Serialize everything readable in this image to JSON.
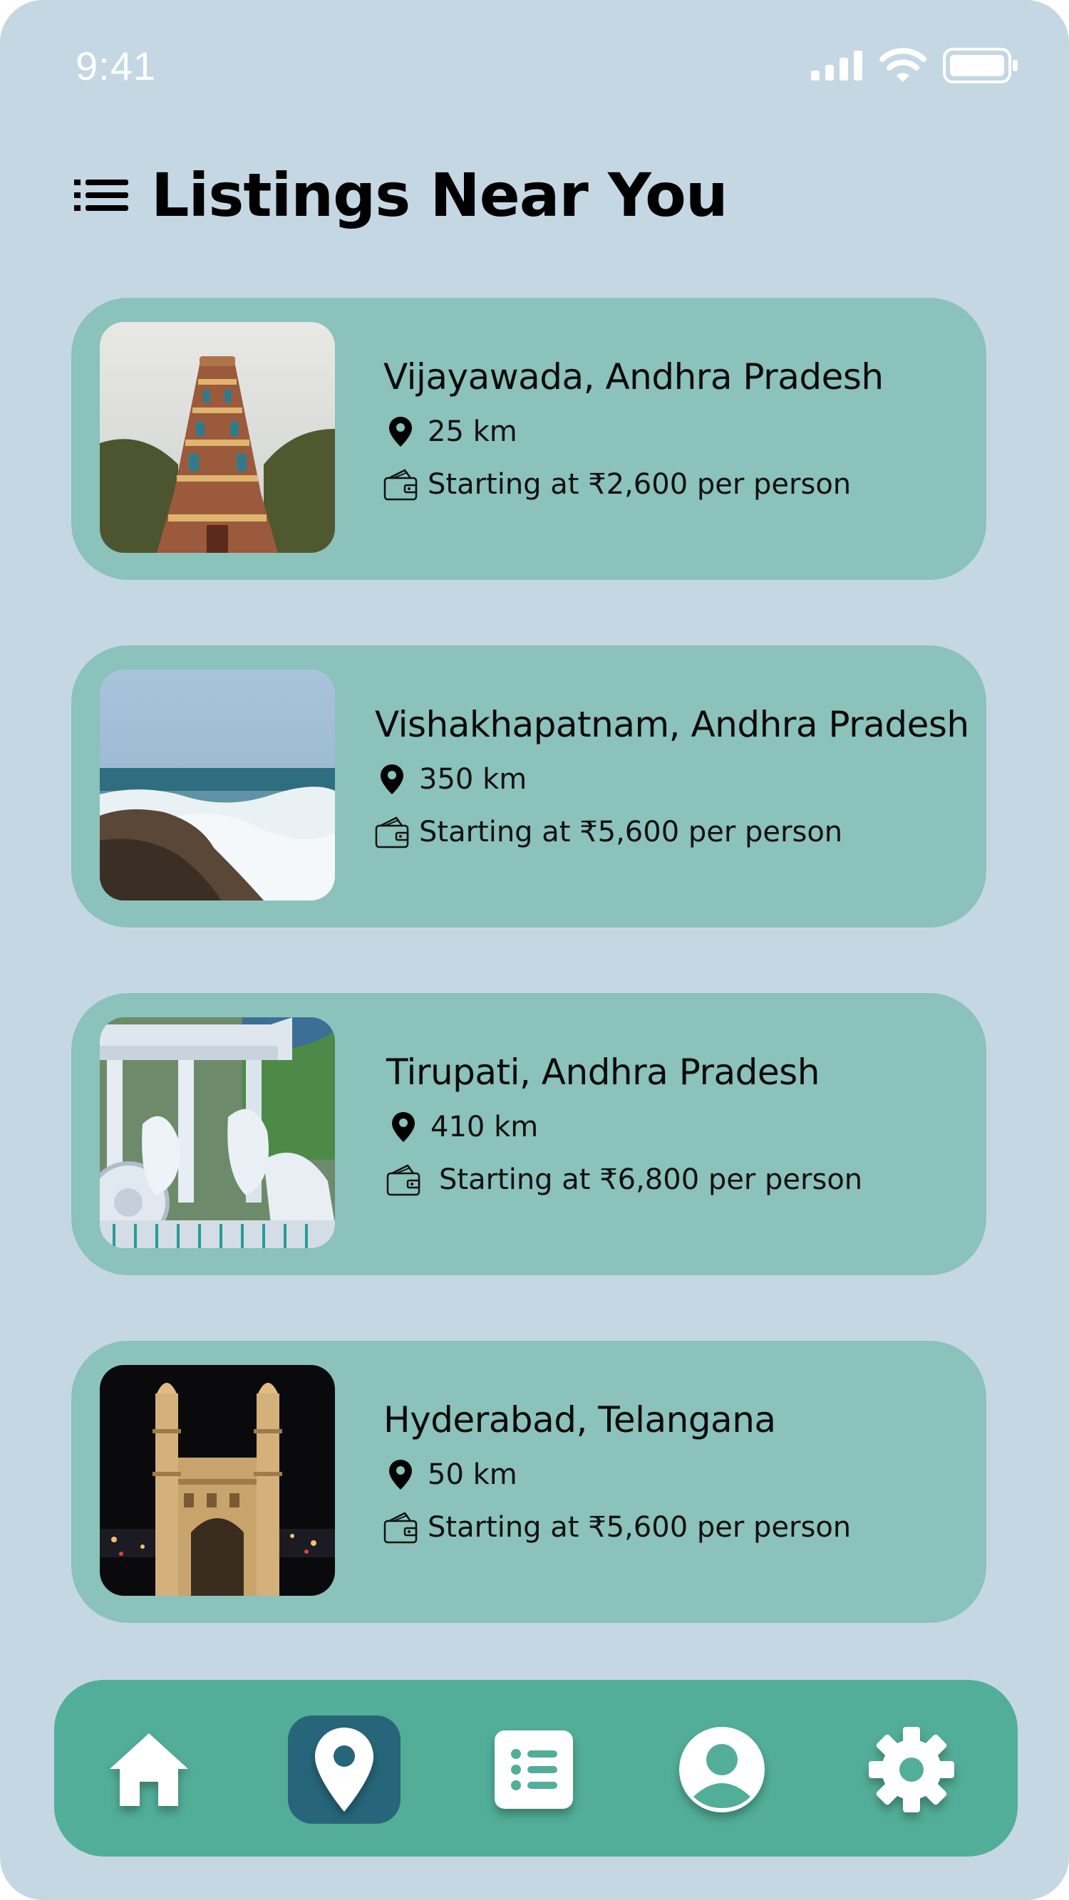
{
  "status_bar": {
    "time": "9:41",
    "icons": [
      "signal-icon",
      "wifi-icon",
      "battery-icon"
    ]
  },
  "header": {
    "icon": "list-icon",
    "title": "Listings Near You"
  },
  "listings": [
    {
      "title": "Vijayawada, Andhra Pradesh",
      "distance": "25 km",
      "price": "Starting at ₹2,600 per person",
      "image": "temple-gopuram"
    },
    {
      "title": "Vishakhapatnam, Andhra Pradesh",
      "distance": "350 km",
      "price": "Starting at ₹5,600 per person",
      "image": "sea-waves-rocks"
    },
    {
      "title": "Tirupati, Andhra Pradesh",
      "distance": "410 km",
      "price": "Starting at ₹6,800 per person",
      "image": "white-chariot-statue"
    },
    {
      "title": "Hyderabad, Telangana",
      "distance": "50 km",
      "price": "Starting at ₹5,600 per person",
      "image": "charminar-night"
    }
  ],
  "bottom_nav": {
    "items": [
      "home-icon",
      "location-pin-icon",
      "list-icon",
      "profile-icon",
      "settings-icon"
    ],
    "active": "location-pin-icon"
  },
  "colors": {
    "background": "#c5d7e3",
    "card": "#8bc2bb",
    "nav_bar": "#52ae98",
    "nav_active": "#27667a"
  }
}
